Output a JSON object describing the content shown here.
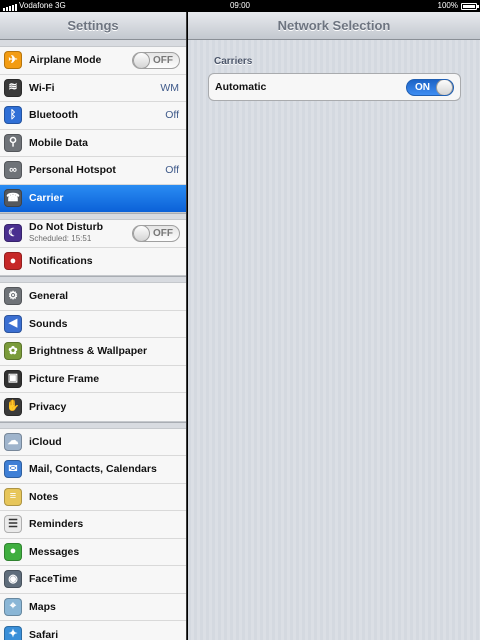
{
  "status": {
    "carrier": "Vodafone 3G",
    "time": "09:00",
    "battery": "100%"
  },
  "master": {
    "title": "Settings",
    "groups": [
      [
        {
          "label": "Airplane Mode",
          "icon": "airplane-icon",
          "color": "#f39c12",
          "toggle": "OFF"
        },
        {
          "label": "Wi-Fi",
          "icon": "wifi-icon",
          "color": "#3a3a3a",
          "value": "WM"
        },
        {
          "label": "Bluetooth",
          "icon": "bluetooth-icon",
          "color": "#2f6fd6",
          "value": "Off"
        },
        {
          "label": "Mobile Data",
          "icon": "antenna-icon",
          "color": "#6f7378"
        },
        {
          "label": "Personal Hotspot",
          "icon": "hotspot-icon",
          "color": "#6f7378",
          "value": "Off"
        },
        {
          "label": "Carrier",
          "icon": "phone-icon",
          "color": "#55595e",
          "selected": true
        }
      ],
      [
        {
          "label": "Do Not Disturb",
          "sub": "Scheduled: 15:51",
          "icon": "moon-icon",
          "color": "#4a2f8f",
          "toggle": "OFF"
        },
        {
          "label": "Notifications",
          "icon": "notifications-icon",
          "color": "#c62828"
        }
      ],
      [
        {
          "label": "General",
          "icon": "gear-icon",
          "color": "#6f7378"
        },
        {
          "label": "Sounds",
          "icon": "speaker-icon",
          "color": "#3b6fd1"
        },
        {
          "label": "Brightness & Wallpaper",
          "icon": "flower-icon",
          "color": "#7a9b3a"
        },
        {
          "label": "Picture Frame",
          "icon": "picture-frame-icon",
          "color": "#333"
        },
        {
          "label": "Privacy",
          "icon": "hand-icon",
          "color": "#3a3a3a"
        }
      ],
      [
        {
          "label": "iCloud",
          "icon": "cloud-icon",
          "color": "#9fb4cc"
        },
        {
          "label": "Mail, Contacts, Calendars",
          "icon": "mail-icon",
          "color": "#3e7fd6"
        },
        {
          "label": "Notes",
          "icon": "notes-icon",
          "color": "#e7c65a"
        },
        {
          "label": "Reminders",
          "icon": "reminders-icon",
          "color": "#eaeaea"
        },
        {
          "label": "Messages",
          "icon": "messages-icon",
          "color": "#3fae3f"
        },
        {
          "label": "FaceTime",
          "icon": "facetime-icon",
          "color": "#5f6d7b"
        },
        {
          "label": "Maps",
          "icon": "maps-icon",
          "color": "#8ab6d6"
        },
        {
          "label": "Safari",
          "icon": "safari-icon",
          "color": "#3a8fd8"
        }
      ]
    ]
  },
  "detail": {
    "title": "Network Selection",
    "section": "Carriers",
    "row_label": "Automatic",
    "toggle": "ON"
  }
}
